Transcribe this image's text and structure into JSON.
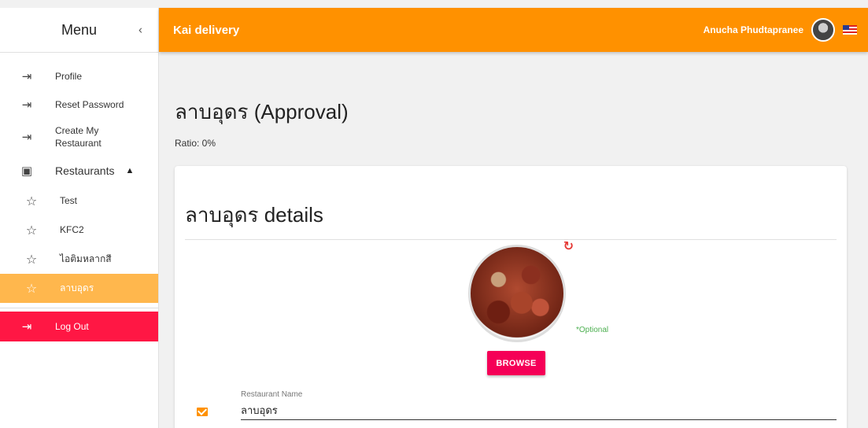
{
  "sidebar": {
    "title": "Menu",
    "collapse_icon": "‹",
    "items": [
      {
        "label": "Profile",
        "icon": "login-icon"
      },
      {
        "label": "Reset Password",
        "icon": "login-icon"
      },
      {
        "label": "Create My Restaurant",
        "icon": "login-icon"
      }
    ],
    "restaurants_section": {
      "label": "Restaurants",
      "icon": "inbox-icon",
      "chevron": "▲"
    },
    "restaurants": [
      {
        "label": "Test"
      },
      {
        "label": "KFC2"
      },
      {
        "label": "ไอติมหลากสี"
      },
      {
        "label": "ลาบอุดร",
        "active": true
      }
    ],
    "logout_label": "Log Out"
  },
  "topbar": {
    "brand": "Kai delivery",
    "user_name": "Anucha Phudtapranee",
    "color": "#ff9100"
  },
  "page": {
    "title": "ลาบอุดร (Approval)",
    "ratio": "Ratio: 0%"
  },
  "card": {
    "title": "ลาบอุดร details",
    "optional_note": "*Optional",
    "browse_label": "BROWSE",
    "refresh_icon": "↻"
  },
  "form": {
    "restaurant_name_label": "Restaurant Name",
    "restaurant_name_value": "ลาบอุดร"
  },
  "colors": {
    "accent": "#ff9100",
    "active_item": "#ffb74d",
    "logout": "#ff1744",
    "browse": "#f50057"
  }
}
